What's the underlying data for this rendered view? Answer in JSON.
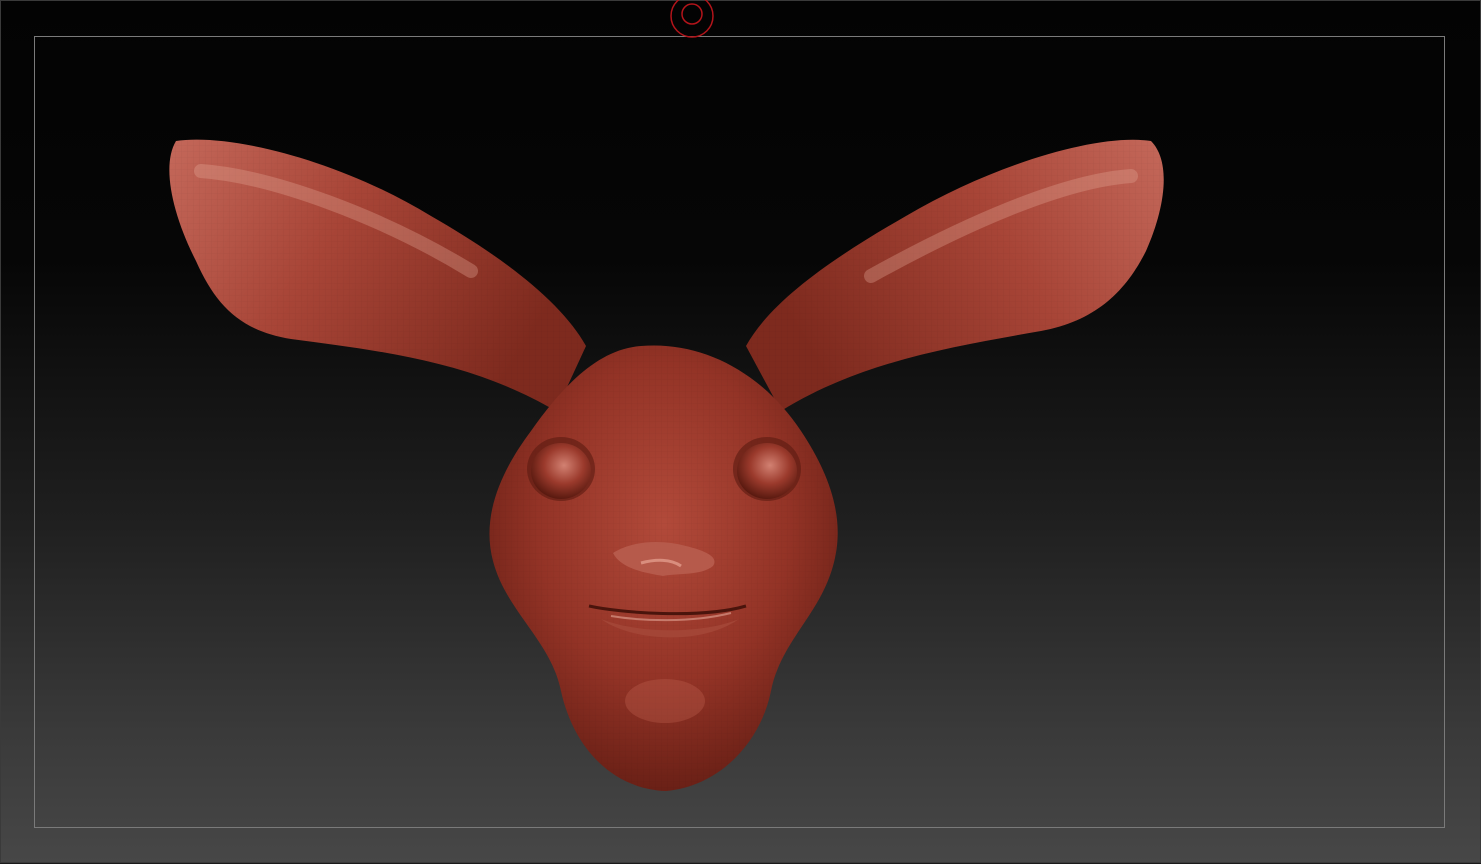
{
  "viewport": {
    "background_top": "#030303",
    "background_bottom": "#474747",
    "frame_color": "#7a7a7a"
  },
  "pivot_marker": {
    "icon": "rotation-pivot-icon",
    "color": "#b3141a"
  },
  "model": {
    "icon": "rabbit-head-sculpt",
    "material_color": "#9b3a2c",
    "highlight_color": "#d88878",
    "shadow_color": "#5a1a10"
  }
}
